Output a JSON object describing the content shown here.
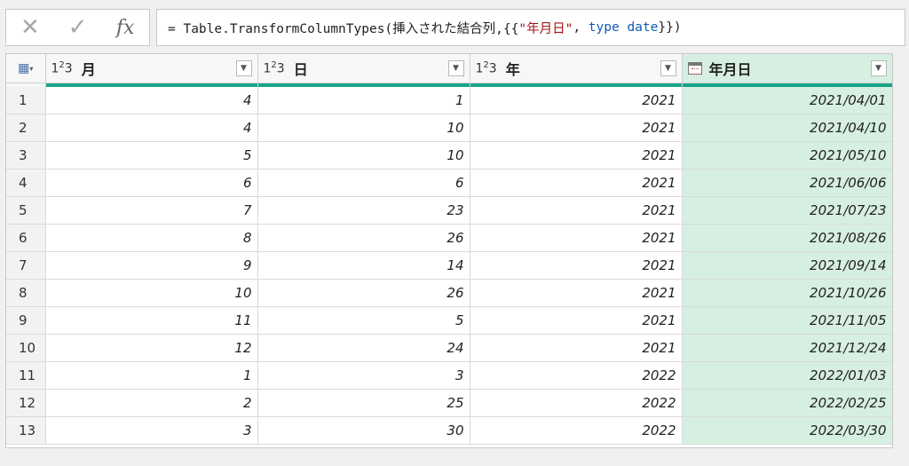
{
  "formula_bar": {
    "cancel_icon": "close-icon",
    "confirm_icon": "check-icon",
    "fx_label": "fx",
    "prefix": "= Table.TransformColumnTypes(挿入された結合列,{{",
    "string": "\"年月日\"",
    "sep": ", ",
    "keyword": "type",
    "type_name": " date",
    "suffix": "}})"
  },
  "columns": [
    {
      "type": "123",
      "name": "月"
    },
    {
      "type": "123",
      "name": "日"
    },
    {
      "type": "123",
      "name": "年"
    },
    {
      "type": "date",
      "name": "年月日"
    }
  ],
  "rows": [
    {
      "idx": "1",
      "m": "4",
      "d": "1",
      "y": "2021",
      "ymd": "2021/04/01"
    },
    {
      "idx": "2",
      "m": "4",
      "d": "10",
      "y": "2021",
      "ymd": "2021/04/10"
    },
    {
      "idx": "3",
      "m": "5",
      "d": "10",
      "y": "2021",
      "ymd": "2021/05/10"
    },
    {
      "idx": "4",
      "m": "6",
      "d": "6",
      "y": "2021",
      "ymd": "2021/06/06"
    },
    {
      "idx": "5",
      "m": "7",
      "d": "23",
      "y": "2021",
      "ymd": "2021/07/23"
    },
    {
      "idx": "6",
      "m": "8",
      "d": "26",
      "y": "2021",
      "ymd": "2021/08/26"
    },
    {
      "idx": "7",
      "m": "9",
      "d": "14",
      "y": "2021",
      "ymd": "2021/09/14"
    },
    {
      "idx": "8",
      "m": "10",
      "d": "26",
      "y": "2021",
      "ymd": "2021/10/26"
    },
    {
      "idx": "9",
      "m": "11",
      "d": "5",
      "y": "2021",
      "ymd": "2021/11/05"
    },
    {
      "idx": "10",
      "m": "12",
      "d": "24",
      "y": "2021",
      "ymd": "2021/12/24"
    },
    {
      "idx": "11",
      "m": "1",
      "d": "3",
      "y": "2022",
      "ymd": "2022/01/03"
    },
    {
      "idx": "12",
      "m": "2",
      "d": "25",
      "y": "2022",
      "ymd": "2022/02/25"
    },
    {
      "idx": "13",
      "m": "3",
      "d": "30",
      "y": "2022",
      "ymd": "2022/03/30"
    }
  ],
  "colors": {
    "selected_column": "#d6efe1",
    "quality_bar": "#19a58b"
  }
}
